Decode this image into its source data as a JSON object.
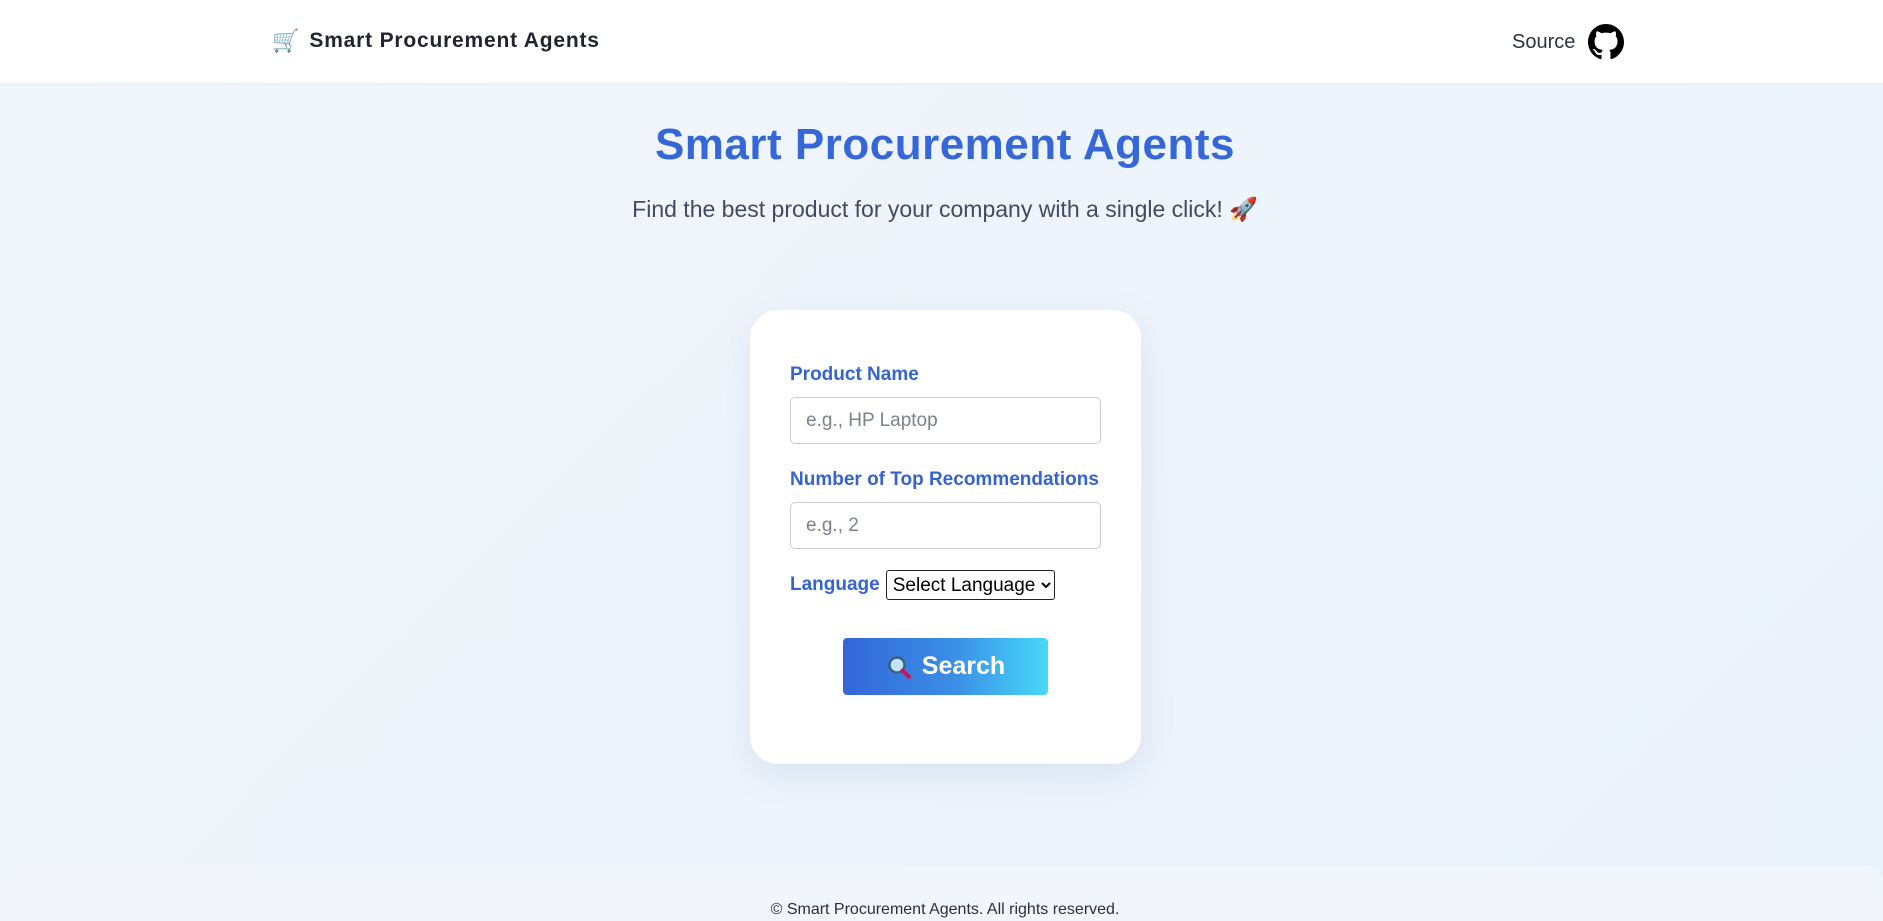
{
  "navbar": {
    "brand_icon": "shopping-cart-icon",
    "brand_emoji": "🛒",
    "brand_title": "Smart Procurement Agents",
    "source_label": "Source",
    "source_icon": "github-icon"
  },
  "hero": {
    "title": "Smart Procurement Agents",
    "subtitle": "Find the best product for your company with a single click! 🚀"
  },
  "form": {
    "product_label": "Product Name",
    "product_placeholder": "e.g., HP Laptop",
    "product_value": "",
    "count_label": "Number of Top Recommendations",
    "count_placeholder": "e.g., 2",
    "count_value": "",
    "language_label": "Language",
    "language_selected": "Select Language",
    "search_label": "Search",
    "search_icon": "magnifier-icon"
  },
  "footer": {
    "text": "© Smart Procurement Agents. All rights reserved."
  },
  "colors": {
    "accent": "#3567d8",
    "gradient_start": "#3466d8",
    "gradient_end": "#47d9f7",
    "background": "#eef4fb"
  }
}
